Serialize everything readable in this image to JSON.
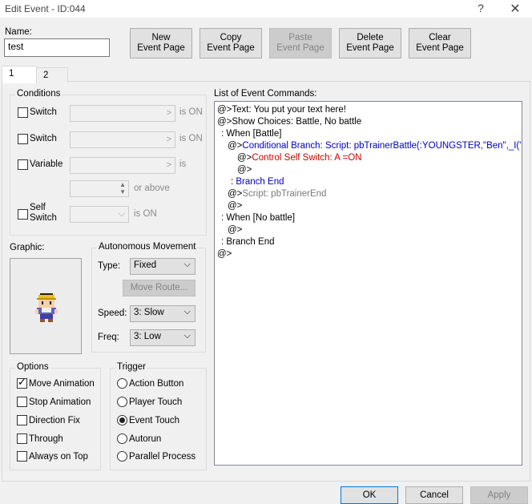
{
  "window": {
    "title": "Edit Event - ID:044",
    "help_glyph": "?",
    "close_glyph": "✕"
  },
  "name": {
    "label": "Name:",
    "value": "test"
  },
  "toolbar": {
    "new_page": "New\nEvent Page",
    "copy_page": "Copy\nEvent Page",
    "paste_page": "Paste\nEvent Page",
    "delete_page": "Delete\nEvent Page",
    "clear_page": "Clear\nEvent Page"
  },
  "tabs": [
    {
      "label": "1"
    },
    {
      "label": "2"
    }
  ],
  "conditions": {
    "title": "Conditions",
    "switch1": {
      "label": "Switch",
      "suffix": "is ON"
    },
    "switch2": {
      "label": "Switch",
      "suffix": "is ON"
    },
    "variable": {
      "label": "Variable",
      "suffix": "is",
      "above": "or above"
    },
    "self_switch": {
      "label": "Self\nSwitch",
      "suffix": "is ON"
    }
  },
  "graphic": {
    "label": "Graphic:"
  },
  "movement": {
    "title": "Autonomous Movement",
    "type_label": "Type:",
    "type_value": "Fixed",
    "move_route": "Move Route...",
    "speed_label": "Speed:",
    "speed_value": "3: Slow",
    "freq_label": "Freq:",
    "freq_value": "3: Low"
  },
  "options": {
    "title": "Options",
    "items": [
      {
        "label": "Move Animation",
        "checked": true
      },
      {
        "label": "Stop Animation",
        "checked": false
      },
      {
        "label": "Direction Fix",
        "checked": false
      },
      {
        "label": "Through",
        "checked": false
      },
      {
        "label": "Always on Top",
        "checked": false
      }
    ]
  },
  "trigger": {
    "title": "Trigger",
    "items": [
      {
        "label": "Action Button",
        "selected": false
      },
      {
        "label": "Player Touch",
        "selected": false
      },
      {
        "label": "Event Touch",
        "selected": true
      },
      {
        "label": "Autorun",
        "selected": false
      },
      {
        "label": "Parallel Process",
        "selected": false
      }
    ]
  },
  "commands": {
    "title": "List of Event Commands:",
    "lines": [
      {
        "prefix": "@>",
        "text": "Text: You put your text here!",
        "color": "black"
      },
      {
        "prefix": "@>",
        "text": "Show Choices: Battle, No battle",
        "color": "black"
      },
      {
        "prefix": " : ",
        "text": "When [Battle]",
        "color": "black"
      },
      {
        "prefix": "@>",
        "text": "Conditional Branch: Script: pbTrainerBattle(:YOUNGSTER,\"Ben\",_I(\"Aww,",
        "color": "blue"
      },
      {
        "prefix": "@>",
        "text": "Control Self Switch: A =ON",
        "color": "red"
      },
      {
        "prefix": "@>",
        "text": "",
        "color": "black"
      },
      {
        "prefix": " : ",
        "text": "Branch End",
        "color": "blue"
      },
      {
        "prefix": "@>",
        "text": "Script: pbTrainerEnd",
        "color": "gray"
      },
      {
        "prefix": "@>",
        "text": "",
        "color": "black"
      },
      {
        "prefix": " : ",
        "text": "When [No battle]",
        "color": "black"
      },
      {
        "prefix": "@>",
        "text": "",
        "color": "black"
      },
      {
        "prefix": " : ",
        "text": "Branch End",
        "color": "black"
      },
      {
        "prefix": "@>",
        "text": "",
        "color": "black"
      }
    ]
  },
  "footer": {
    "ok": "OK",
    "cancel": "Cancel",
    "apply": "Apply"
  }
}
